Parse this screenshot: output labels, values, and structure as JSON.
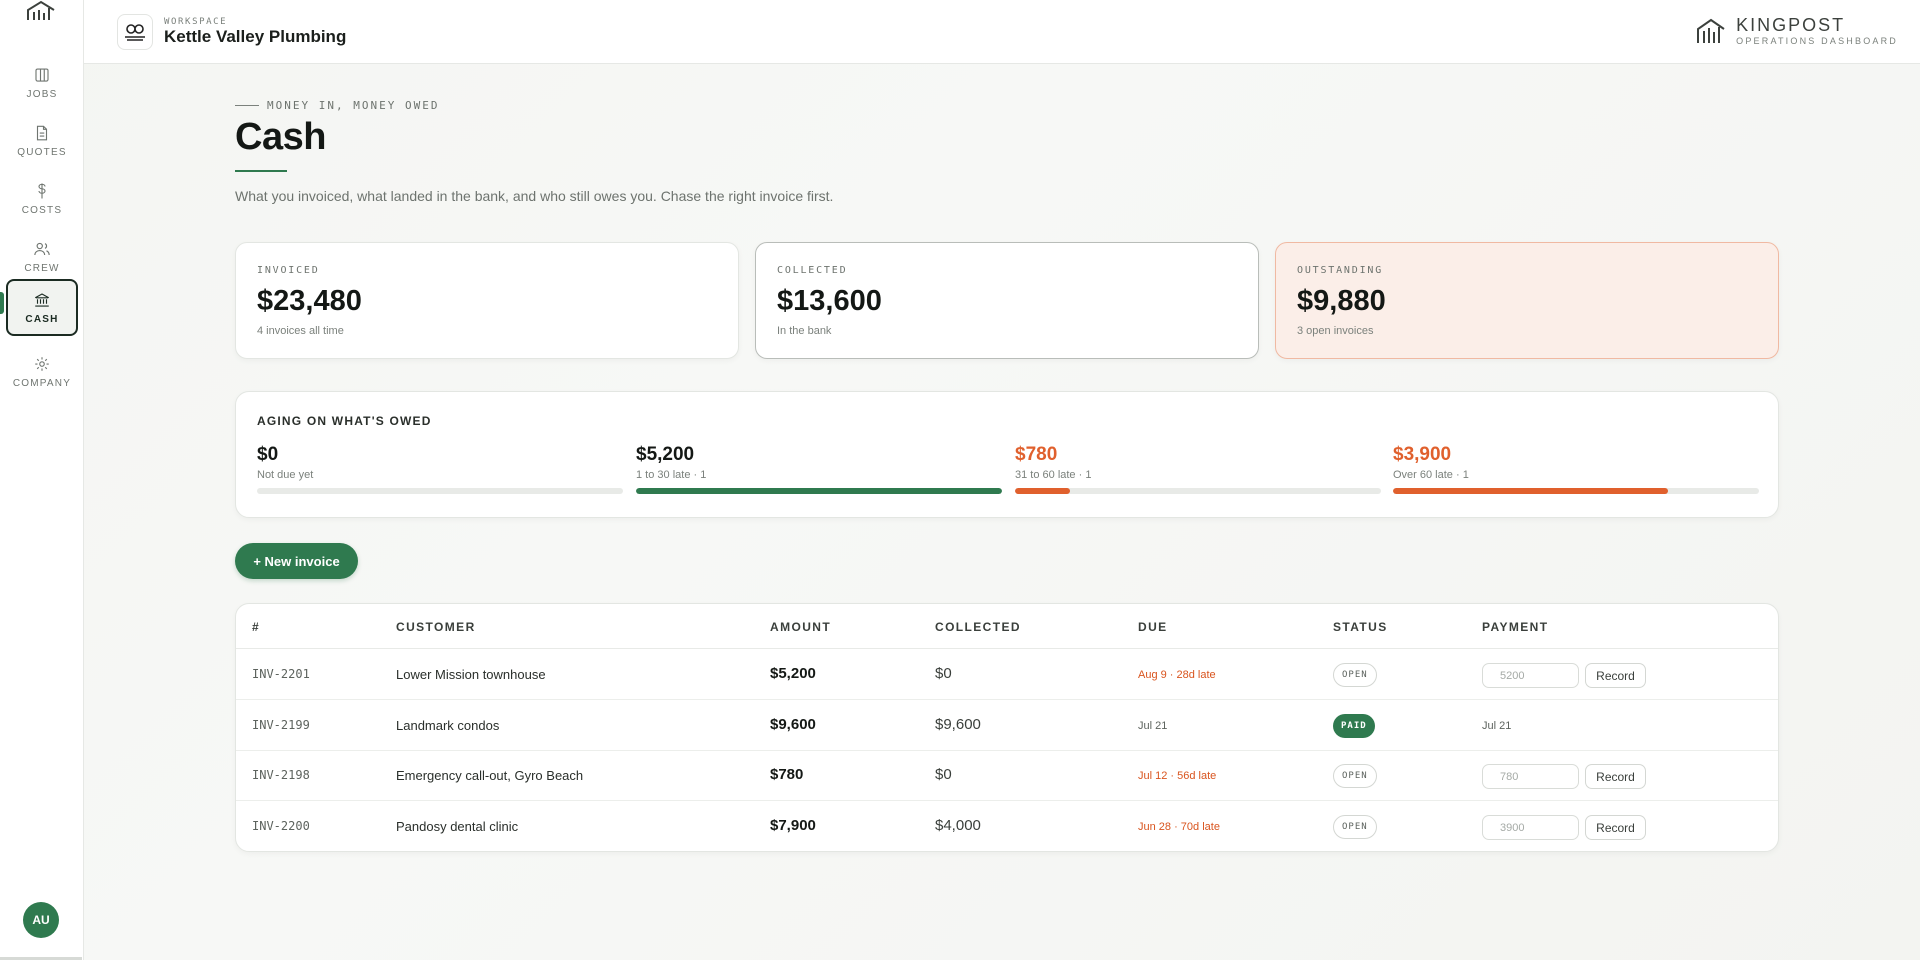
{
  "sidebar": {
    "items": [
      {
        "key": "jobs",
        "label": "JOBS",
        "icon": "columns-icon"
      },
      {
        "key": "quotes",
        "label": "QUOTES",
        "icon": "document-icon"
      },
      {
        "key": "costs",
        "label": "COSTS",
        "icon": "dollar-icon"
      },
      {
        "key": "crew",
        "label": "CREW",
        "icon": "users-icon"
      },
      {
        "key": "cash",
        "label": "CASH",
        "icon": "bank-icon",
        "active": true
      },
      {
        "key": "company",
        "label": "COMPANY",
        "icon": "gear-icon"
      }
    ],
    "avatar_initials": "AU"
  },
  "topbar": {
    "workspace_kicker": "WORKSPACE",
    "workspace_name": "Kettle Valley Plumbing",
    "brand_name": "KINGPOST",
    "brand_sub": "OPERATIONS DASHBOARD"
  },
  "page": {
    "eyebrow": "MONEY IN, MONEY OWED",
    "title": "Cash",
    "subtitle": "What you invoiced, what landed in the bank, and who still owes you. Chase the right invoice first."
  },
  "stats": {
    "invoiced": {
      "label": "INVOICED",
      "value": "$23,480",
      "sub": "4 invoices all time"
    },
    "collected": {
      "label": "COLLECTED",
      "value": "$13,600",
      "sub": "In the bank"
    },
    "outstanding": {
      "label": "OUTSTANDING",
      "value": "$9,880",
      "sub": "3 open invoices"
    }
  },
  "aging": {
    "heading": "AGING ON WHAT'S OWED",
    "buckets": [
      {
        "value": "$0",
        "sub": "Not due yet",
        "fill_pct": 0,
        "color": "#2f7a4f",
        "orange": false
      },
      {
        "value": "$5,200",
        "sub": "1 to 30 late · 1",
        "fill_pct": 100,
        "color": "#2f7a4f",
        "orange": false
      },
      {
        "value": "$780",
        "sub": "31 to 60 late · 1",
        "fill_pct": 15,
        "color": "#e0602d",
        "orange": true
      },
      {
        "value": "$3,900",
        "sub": "Over 60 late · 1",
        "fill_pct": 75,
        "color": "#e0602d",
        "orange": true
      }
    ]
  },
  "actions": {
    "new_invoice": "+ New invoice"
  },
  "table": {
    "headers": [
      "#",
      "CUSTOMER",
      "AMOUNT",
      "COLLECTED",
      "DUE",
      "STATUS",
      "PAYMENT"
    ],
    "rows": [
      {
        "num": "INV-2201",
        "customer": "Lower Mission townhouse",
        "amount": "$5,200",
        "collected": "$0",
        "due": "Aug 9 · 28d late",
        "late": true,
        "status": "OPEN",
        "payment_placeholder": "5200",
        "record": "Record"
      },
      {
        "num": "INV-2199",
        "customer": "Landmark condos",
        "amount": "$9,600",
        "collected": "$9,600",
        "due": "Jul 21",
        "late": false,
        "status": "PAID",
        "paid_date": "Jul 21"
      },
      {
        "num": "INV-2198",
        "customer": "Emergency call-out, Gyro Beach",
        "amount": "$780",
        "collected": "$0",
        "due": "Jul 12 · 56d late",
        "late": true,
        "status": "OPEN",
        "payment_placeholder": "780",
        "record": "Record"
      },
      {
        "num": "INV-2200",
        "customer": "Pandosy dental clinic",
        "amount": "$7,900",
        "collected": "$4,000",
        "due": "Jun 28 · 70d late",
        "late": true,
        "status": "OPEN",
        "payment_placeholder": "3900",
        "record": "Record"
      }
    ]
  },
  "colors": {
    "accent": "#2f7a4f",
    "warning": "#e0602d",
    "warning_bg": "#fbeee8"
  }
}
